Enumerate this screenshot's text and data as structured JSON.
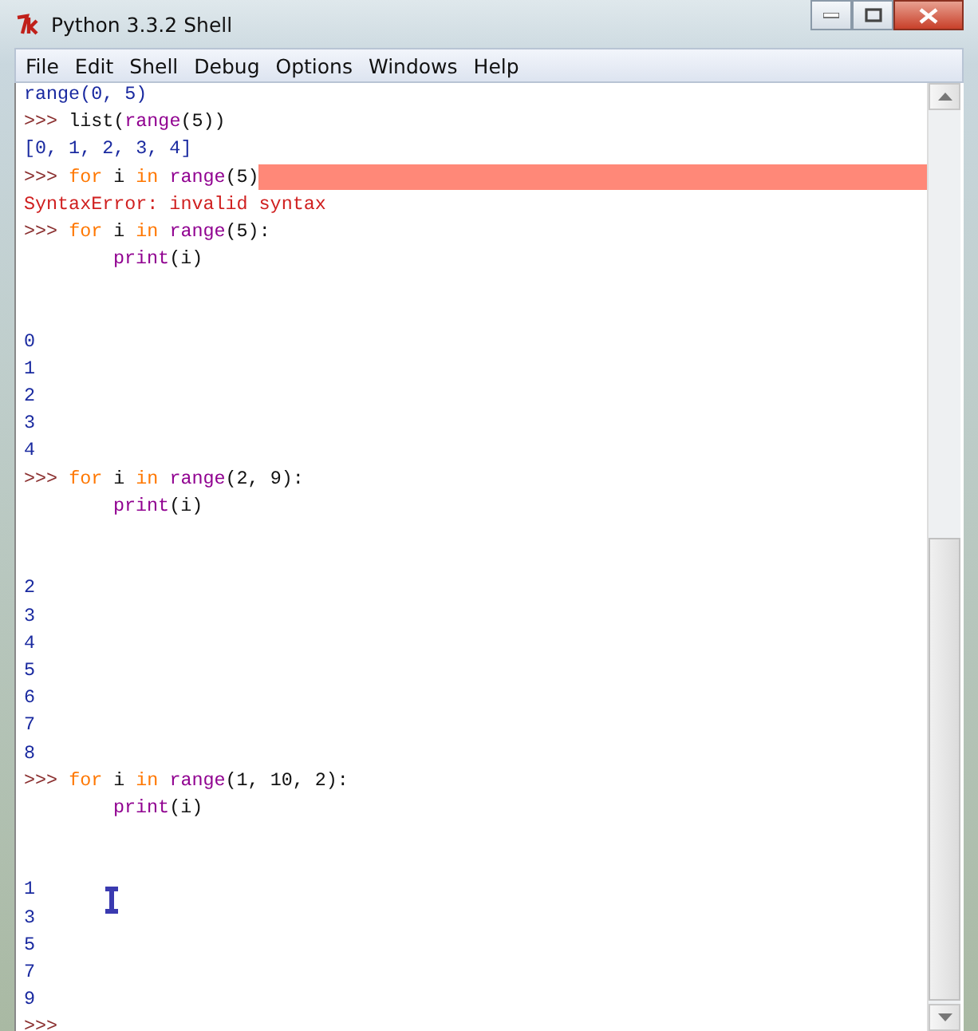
{
  "window": {
    "title": "Python 3.3.2 Shell"
  },
  "menu": [
    "File",
    "Edit",
    "Shell",
    "Debug",
    "Options",
    "Windows",
    "Help"
  ],
  "lines": [
    {
      "kind": "text",
      "segments": [
        {
          "kind": "output",
          "text": "range(0, 5)"
        }
      ]
    },
    {
      "kind": "text",
      "segments": [
        {
          "kind": "prompt",
          "text": ">>> "
        },
        {
          "kind": "plain",
          "text": "list("
        },
        {
          "kind": "builtin",
          "text": "range"
        },
        {
          "kind": "plain",
          "text": "(5))"
        }
      ]
    },
    {
      "kind": "text",
      "segments": [
        {
          "kind": "output",
          "text": "[0, 1, 2, 3, 4]"
        }
      ]
    },
    {
      "kind": "text",
      "highlight": true,
      "segments": [
        {
          "kind": "prompt",
          "text": ">>> "
        },
        {
          "kind": "keyword",
          "text": "for"
        },
        {
          "kind": "plain",
          "text": " i "
        },
        {
          "kind": "keyword",
          "text": "in"
        },
        {
          "kind": "builtin",
          "text": " range"
        },
        {
          "kind": "plain",
          "text": "(5)"
        }
      ]
    },
    {
      "kind": "text",
      "segments": [
        {
          "kind": "error",
          "text": "SyntaxError: invalid syntax"
        }
      ]
    },
    {
      "kind": "text",
      "segments": [
        {
          "kind": "prompt",
          "text": ">>> "
        },
        {
          "kind": "keyword",
          "text": "for"
        },
        {
          "kind": "plain",
          "text": " i "
        },
        {
          "kind": "keyword",
          "text": "in"
        },
        {
          "kind": "builtin",
          "text": " range"
        },
        {
          "kind": "plain",
          "text": "(5):"
        }
      ]
    },
    {
      "kind": "text",
      "indent": true,
      "segments": [
        {
          "kind": "builtin",
          "text": "print"
        },
        {
          "kind": "plain",
          "text": "(i)"
        }
      ]
    },
    {
      "kind": "blank"
    },
    {
      "kind": "blank"
    },
    {
      "kind": "text",
      "segments": [
        {
          "kind": "output",
          "text": "0"
        }
      ]
    },
    {
      "kind": "text",
      "segments": [
        {
          "kind": "output",
          "text": "1"
        }
      ]
    },
    {
      "kind": "text",
      "segments": [
        {
          "kind": "output",
          "text": "2"
        }
      ]
    },
    {
      "kind": "text",
      "segments": [
        {
          "kind": "output",
          "text": "3"
        }
      ]
    },
    {
      "kind": "text",
      "segments": [
        {
          "kind": "output",
          "text": "4"
        }
      ]
    },
    {
      "kind": "text",
      "segments": [
        {
          "kind": "prompt",
          "text": ">>> "
        },
        {
          "kind": "keyword",
          "text": "for"
        },
        {
          "kind": "plain",
          "text": " i "
        },
        {
          "kind": "keyword",
          "text": "in"
        },
        {
          "kind": "builtin",
          "text": " range"
        },
        {
          "kind": "plain",
          "text": "(2, 9):"
        }
      ]
    },
    {
      "kind": "text",
      "indent": true,
      "segments": [
        {
          "kind": "builtin",
          "text": "print"
        },
        {
          "kind": "plain",
          "text": "(i)"
        }
      ]
    },
    {
      "kind": "blank"
    },
    {
      "kind": "blank"
    },
    {
      "kind": "text",
      "segments": [
        {
          "kind": "output",
          "text": "2"
        }
      ]
    },
    {
      "kind": "text",
      "segments": [
        {
          "kind": "output",
          "text": "3"
        }
      ]
    },
    {
      "kind": "text",
      "segments": [
        {
          "kind": "output",
          "text": "4"
        }
      ]
    },
    {
      "kind": "text",
      "segments": [
        {
          "kind": "output",
          "text": "5"
        }
      ]
    },
    {
      "kind": "text",
      "segments": [
        {
          "kind": "output",
          "text": "6"
        }
      ]
    },
    {
      "kind": "text",
      "segments": [
        {
          "kind": "output",
          "text": "7"
        }
      ]
    },
    {
      "kind": "text",
      "segments": [
        {
          "kind": "output",
          "text": "8"
        }
      ]
    },
    {
      "kind": "text",
      "segments": [
        {
          "kind": "prompt",
          "text": ">>> "
        },
        {
          "kind": "keyword",
          "text": "for"
        },
        {
          "kind": "plain",
          "text": " i "
        },
        {
          "kind": "keyword",
          "text": "in"
        },
        {
          "kind": "builtin",
          "text": " range"
        },
        {
          "kind": "plain",
          "text": "(1, 10, 2):"
        }
      ]
    },
    {
      "kind": "text",
      "indent": true,
      "segments": [
        {
          "kind": "builtin",
          "text": "print"
        },
        {
          "kind": "plain",
          "text": "(i)"
        }
      ]
    },
    {
      "kind": "blank"
    },
    {
      "kind": "blank"
    },
    {
      "kind": "text",
      "segments": [
        {
          "kind": "output",
          "text": "1"
        }
      ]
    },
    {
      "kind": "text",
      "segments": [
        {
          "kind": "output",
          "text": "3"
        }
      ]
    },
    {
      "kind": "text",
      "segments": [
        {
          "kind": "output",
          "text": "5"
        }
      ]
    },
    {
      "kind": "text",
      "segments": [
        {
          "kind": "output",
          "text": "7"
        }
      ]
    },
    {
      "kind": "text",
      "segments": [
        {
          "kind": "output",
          "text": "9"
        }
      ]
    },
    {
      "kind": "text",
      "segments": [
        {
          "kind": "prompt",
          "text": ">>>"
        }
      ]
    }
  ]
}
